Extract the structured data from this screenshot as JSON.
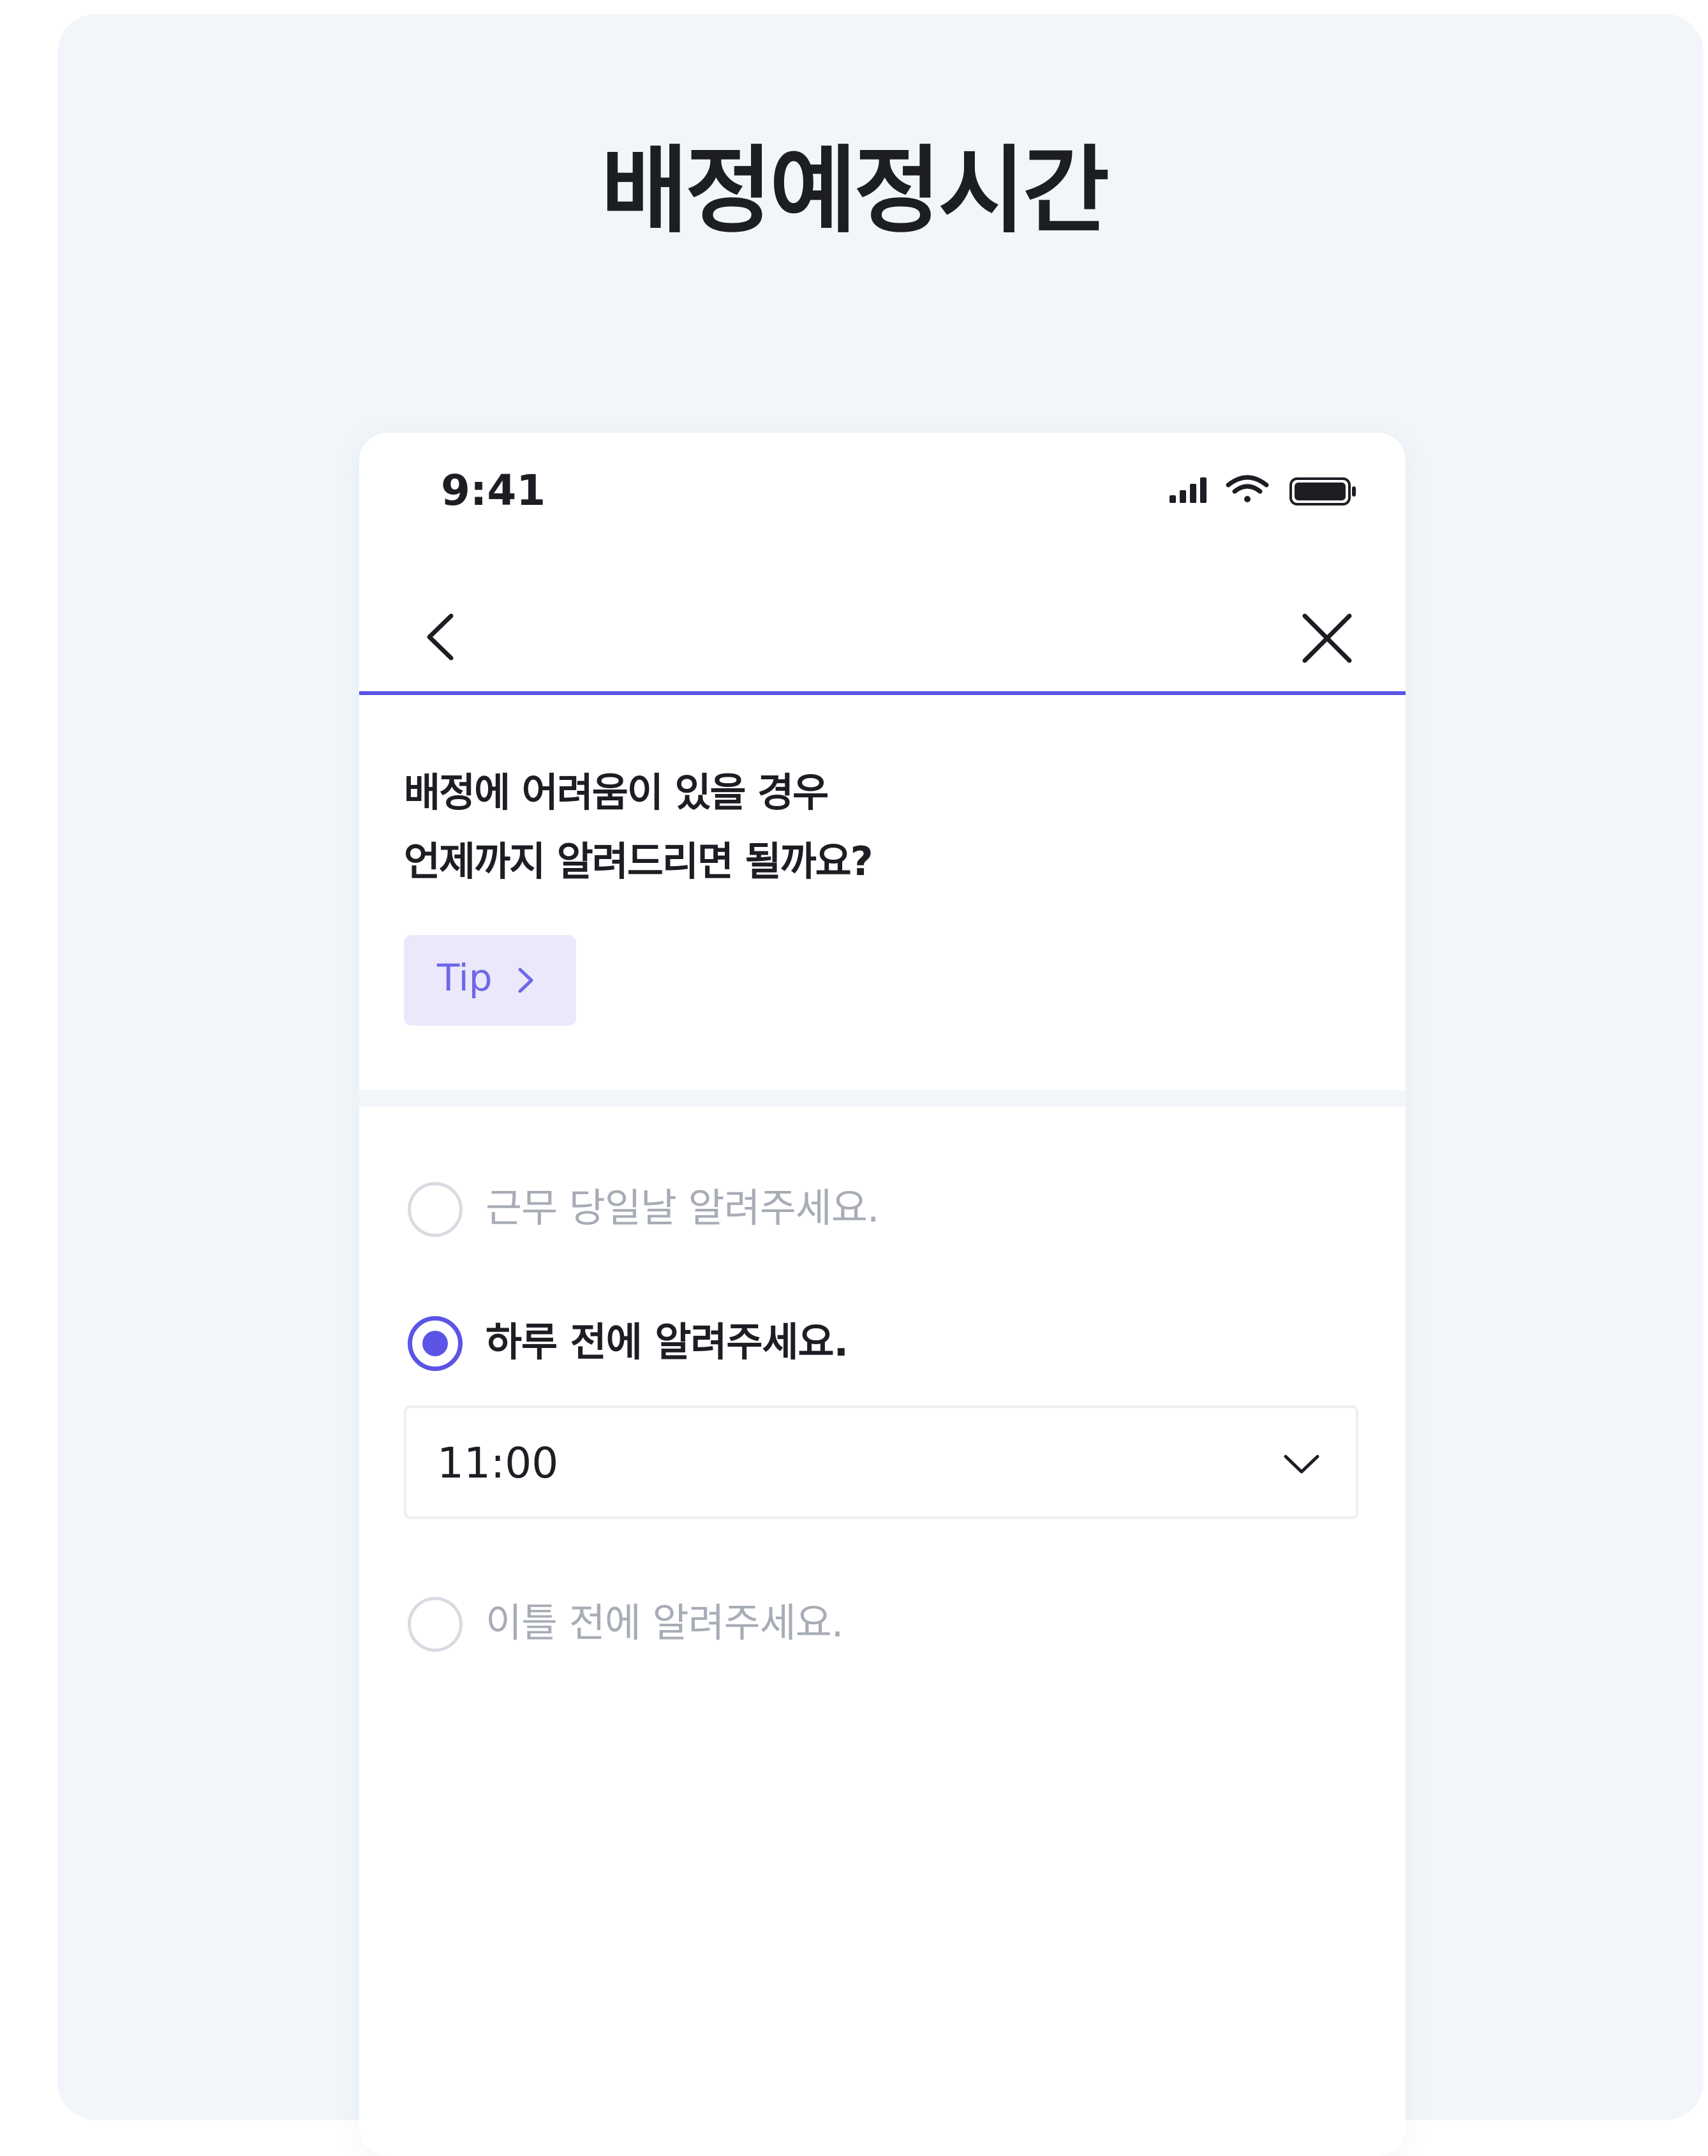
{
  "page": {
    "title": "배정예정시간"
  },
  "status_bar": {
    "time": "9:41",
    "icons": [
      "cellular-signal-icon",
      "wifi-icon",
      "battery-icon"
    ]
  },
  "nav": {
    "back_icon": "chevron-left-icon",
    "close_icon": "close-icon"
  },
  "question": {
    "line1": "배정에 어려움이 있을 경우",
    "line2": "언제까지 알려드리면 될까요?"
  },
  "tip": {
    "label": "Tip",
    "icon": "chevron-right-icon"
  },
  "options": [
    {
      "label": "근무 당일날 알려주세요.",
      "selected": false
    },
    {
      "label": "하루 전에 알려주세요.",
      "selected": true
    },
    {
      "label": "이틀 전에 알려주세요.",
      "selected": false
    }
  ],
  "time_select": {
    "value": "11:00",
    "icon": "chevron-down-icon"
  },
  "colors": {
    "accent": "#5b54e6",
    "tip_background": "#ebe8fc",
    "page_background": "#f2f6fa",
    "text_primary": "#1c1e24",
    "text_muted": "#a7acb6"
  }
}
